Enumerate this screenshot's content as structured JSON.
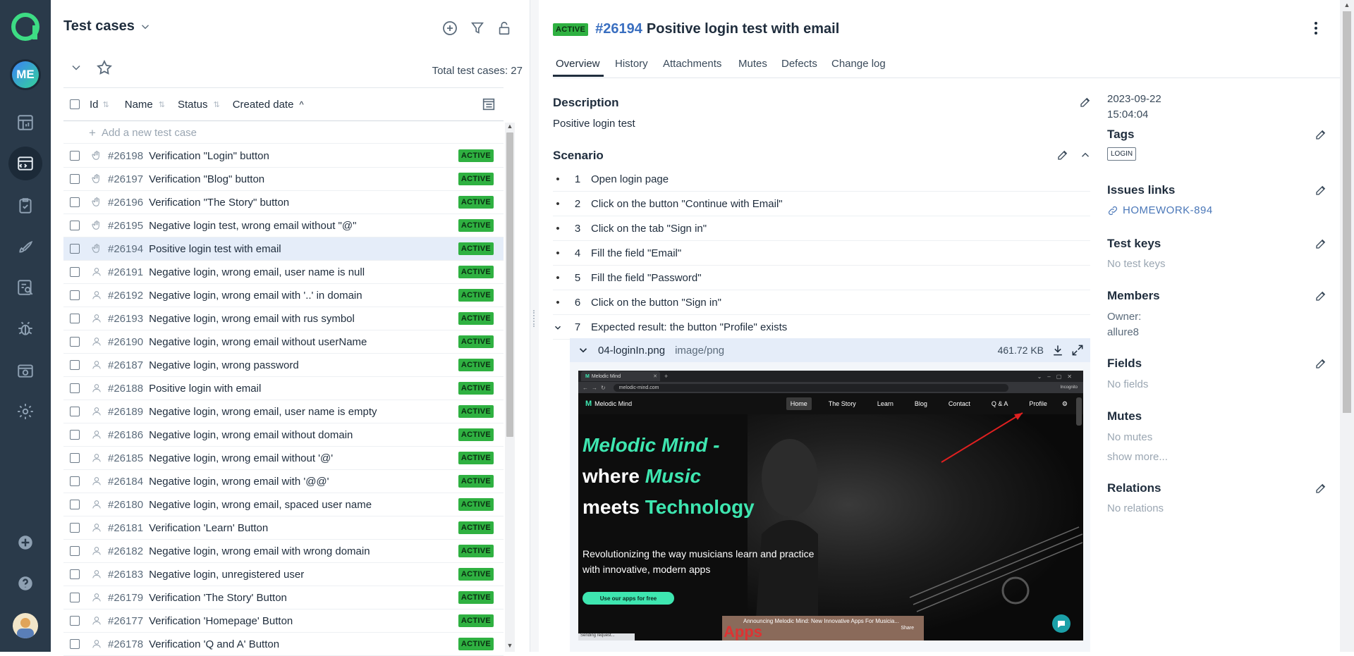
{
  "rail": {
    "avatar_initials": "ME"
  },
  "list": {
    "title": "Test cases",
    "total": "Total test cases: 27",
    "columns": [
      "Id",
      "Name",
      "Status",
      "Created date"
    ],
    "add_placeholder": "Add a new test case",
    "rows": [
      {
        "id": "#26198",
        "name": "Verification \"Login\" button",
        "status": "ACTIVE"
      },
      {
        "id": "#26197",
        "name": "Verification \"Blog\" button",
        "status": "ACTIVE"
      },
      {
        "id": "#26196",
        "name": "Verification \"The Story\" button",
        "status": "ACTIVE"
      },
      {
        "id": "#26195",
        "name": "Negative login test, wrong email without \"@\"",
        "status": "ACTIVE"
      },
      {
        "id": "#26194",
        "name": "Positive login test with email",
        "status": "ACTIVE"
      },
      {
        "id": "#26191",
        "name": "Negative login, wrong email, user name is null",
        "status": "ACTIVE"
      },
      {
        "id": "#26192",
        "name": "Negative login, wrong email with '..' in domain",
        "status": "ACTIVE"
      },
      {
        "id": "#26193",
        "name": "Negative login, wrong email with rus symbol",
        "status": "ACTIVE"
      },
      {
        "id": "#26190",
        "name": "Negative login, wrong email without userName",
        "status": "ACTIVE"
      },
      {
        "id": "#26187",
        "name": "Negative login, wrong password",
        "status": "ACTIVE"
      },
      {
        "id": "#26188",
        "name": "Positive login with email",
        "status": "ACTIVE"
      },
      {
        "id": "#26189",
        "name": "Negative login, wrong email, user name is empty",
        "status": "ACTIVE"
      },
      {
        "id": "#26186",
        "name": "Negative login, wrong email without domain",
        "status": "ACTIVE"
      },
      {
        "id": "#26185",
        "name": "Negative login, wrong email without '@'",
        "status": "ACTIVE"
      },
      {
        "id": "#26184",
        "name": "Negative login, wrong email with '@@'",
        "status": "ACTIVE"
      },
      {
        "id": "#26180",
        "name": "Negative login, wrong email, spaced user name",
        "status": "ACTIVE"
      },
      {
        "id": "#26181",
        "name": "Verification 'Learn' Button",
        "status": "ACTIVE"
      },
      {
        "id": "#26182",
        "name": "Negative login, wrong email with wrong domain",
        "status": "ACTIVE"
      },
      {
        "id": "#26183",
        "name": "Negative login, unregistered user",
        "status": "ACTIVE"
      },
      {
        "id": "#26179",
        "name": "Verification 'The Story' Button",
        "status": "ACTIVE"
      },
      {
        "id": "#26177",
        "name": "Verification 'Homepage' Button",
        "status": "ACTIVE"
      },
      {
        "id": "#26178",
        "name": "Verification 'Q and A' Button",
        "status": "ACTIVE"
      }
    ]
  },
  "detail": {
    "status": "ACTIVE",
    "id": "#26194",
    "title": "Positive login test with email",
    "tabs": [
      "Overview",
      "History",
      "Attachments",
      "Mutes",
      "Defects",
      "Change log"
    ],
    "description_title": "Description",
    "description": "Positive login test",
    "scenario_title": "Scenario",
    "steps": [
      {
        "n": "1",
        "text": "Open login page"
      },
      {
        "n": "2",
        "text": "Click on the button \"Continue with Email\""
      },
      {
        "n": "3",
        "text": "Click on the tab \"Sign in\""
      },
      {
        "n": "4",
        "text": "Fill the field \"Email\""
      },
      {
        "n": "5",
        "text": "Fill the field \"Password\""
      },
      {
        "n": "6",
        "text": "Click on the button \"Sign in\""
      },
      {
        "n": "7",
        "text": "Expected result: the button \"Profile\" exists"
      }
    ],
    "attachment": {
      "name": "04-loginIn.png",
      "type": "image/png",
      "size": "461.72 KB"
    }
  },
  "screenshot": {
    "tab_title": "Melodic Mind",
    "url": "melodic-mind.com",
    "incognito": "Incognito",
    "brand": "Melodic Mind",
    "nav": [
      "Home",
      "The Story",
      "Learn",
      "Blog",
      "Contact",
      "Q & A",
      "Profile"
    ],
    "hero_line1": "Melodic Mind -",
    "hero_line2a": "where ",
    "hero_line2b": "Music",
    "hero_line3a": "meets ",
    "hero_line3b": "Technology",
    "sub1": "Revolutionizing the way musicians learn and practice",
    "sub2": "with innovative, modern apps",
    "cta": "Use our apps for free",
    "video": "Announcing Melodic Mind: New Innovative Apps For Musicia...",
    "apps": "Apps",
    "share": "Share",
    "status_bar": "Sending request..."
  },
  "side": {
    "date": "2023-09-22",
    "time": "15:04:04",
    "tags_title": "Tags",
    "tag": "LOGIN",
    "issues_title": "Issues links",
    "issue": "HOMEWORK-894",
    "keys_title": "Test keys",
    "keys_empty": "No test keys",
    "members_title": "Members",
    "owner_label": "Owner:",
    "owner": "allure8",
    "fields_title": "Fields",
    "fields_empty": "No fields",
    "mutes_title": "Mutes",
    "mutes_empty": "No mutes",
    "show_more": "show more...",
    "relations_title": "Relations",
    "relations_empty": "No relations"
  },
  "colors": {
    "rail": "#2a3a4a",
    "active_badge": "#2fb141",
    "selected_row": "#e5edf9",
    "link": "#4a77b8",
    "accent_text": "#3ee6b0"
  }
}
